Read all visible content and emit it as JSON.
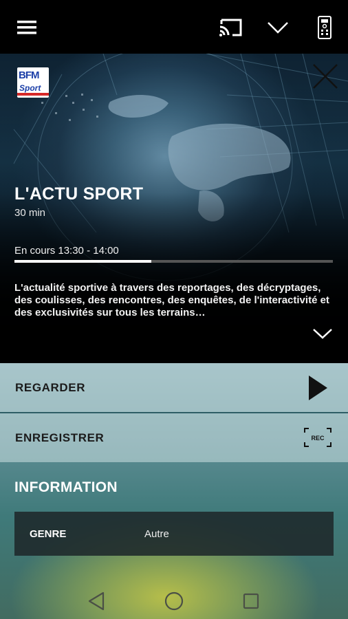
{
  "toolbar": {
    "menu_icon": "hamburger-menu-icon",
    "cast_icon": "cast-icon",
    "collapse_icon": "chevron-down-icon",
    "remote_icon": "remote-control-icon"
  },
  "program": {
    "channel_logo": {
      "line1": "BFM",
      "line2": "Sport"
    },
    "title": "L'ACTU SPORT",
    "duration": "30 min",
    "status": "En cours 13:30 - 14:00",
    "progress": 0.43,
    "description": "L'actualité sportive à travers des reportages, des décryptages, des coulisses, des rencontres, des enquêtes, de l'interactivité et des exclusivités sur tous les terrains…"
  },
  "actions": {
    "watch_label": "REGARDER",
    "record_label": "ENREGISTRER",
    "record_icon_text": "REC"
  },
  "information": {
    "title": "INFORMATION",
    "rows": [
      {
        "key": "GENRE",
        "value": "Autre"
      }
    ]
  },
  "colors": {
    "accent": "#ffffff",
    "action_row_bg": "#c3d9dc",
    "logo_blue": "#1c3fa8",
    "logo_red": "#d62828"
  }
}
